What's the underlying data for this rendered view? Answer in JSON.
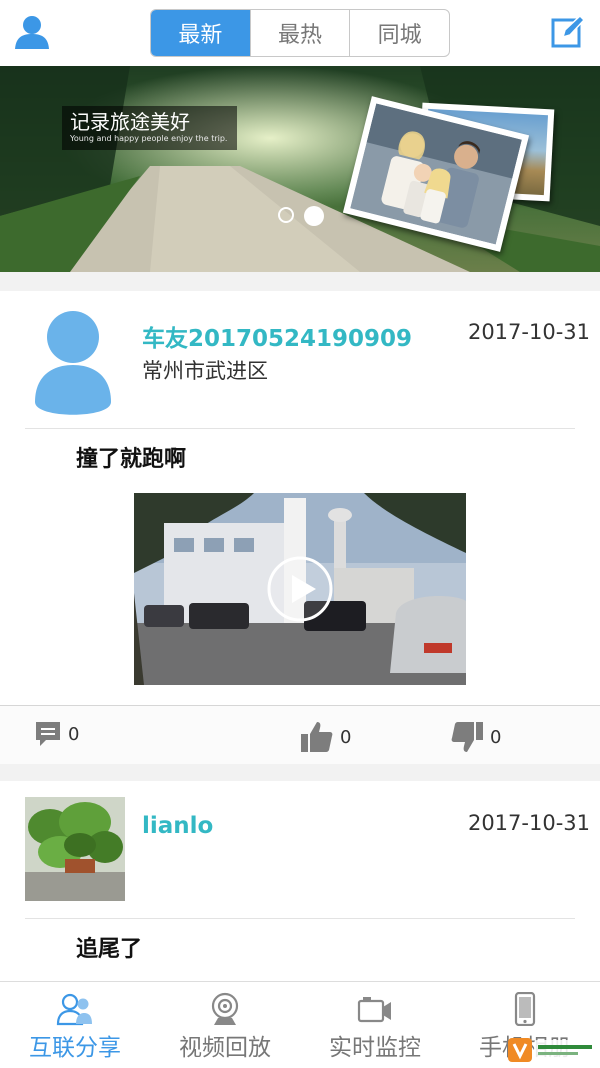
{
  "header": {
    "tabs": [
      {
        "label": "最新",
        "active": true
      },
      {
        "label": "最热",
        "active": false
      },
      {
        "label": "同城",
        "active": false
      }
    ],
    "user_icon": "user-icon",
    "edit_icon": "edit-icon"
  },
  "banner": {
    "title": "记录旅途美好",
    "subtitle": "Young and happy people enjoy the trip."
  },
  "posts": [
    {
      "username": "车友20170524190909",
      "location": "常州市武进区",
      "date": "2017-10-31",
      "title": "撞了就跑啊",
      "comments": "0",
      "likes": "0",
      "dislikes": "0"
    },
    {
      "username": "lianlo",
      "date": "2017-10-31",
      "title": "追尾了"
    }
  ],
  "bottom_nav": [
    {
      "label": "互联分享",
      "icon": "users-icon",
      "active": true
    },
    {
      "label": "视频回放",
      "icon": "camera-icon",
      "active": false
    },
    {
      "label": "实时监控",
      "icon": "video-camera-icon",
      "active": false
    },
    {
      "label": "手机相册",
      "icon": "phone-icon",
      "active": false
    }
  ],
  "colors": {
    "accent": "#3c97e6",
    "username": "#33b8c4"
  }
}
